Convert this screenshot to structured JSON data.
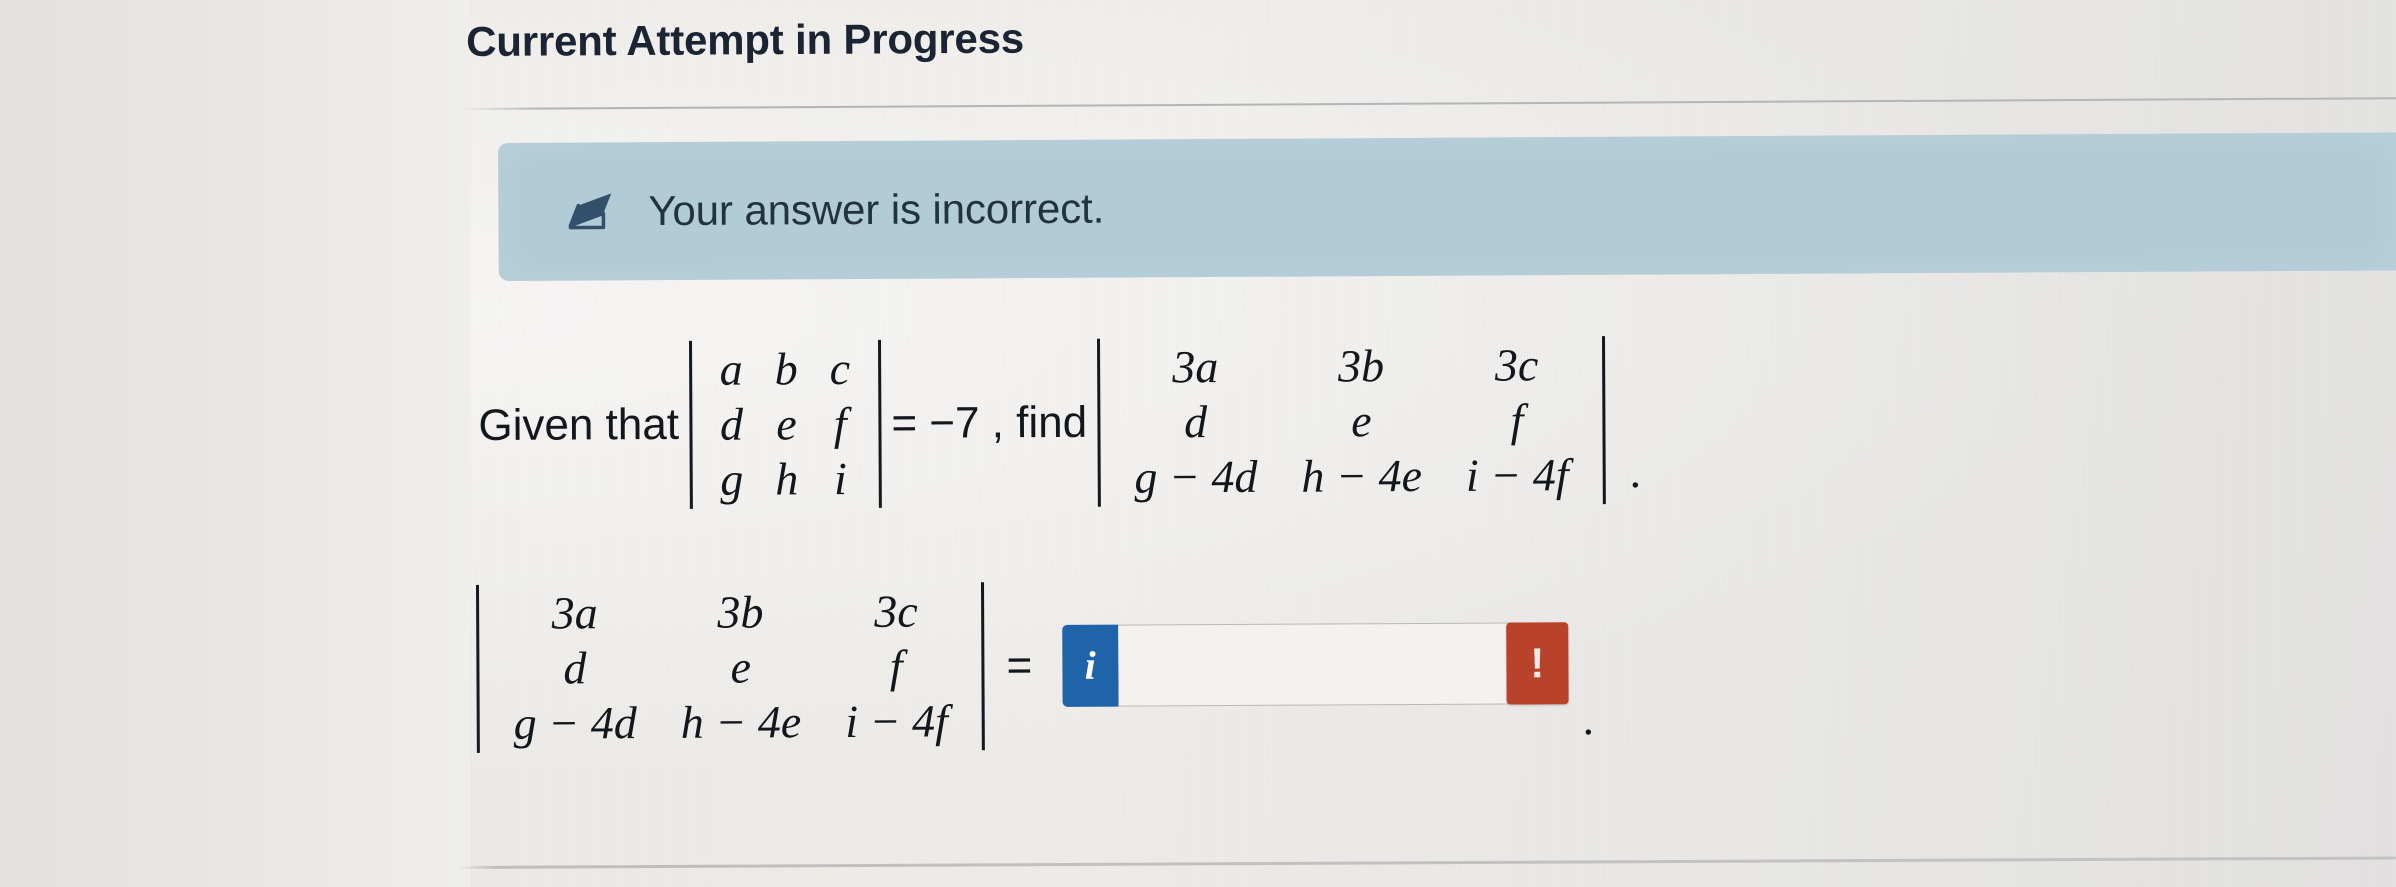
{
  "page": {
    "title": "Current Attempt in Progress"
  },
  "status_banner": {
    "message": "Your answer is incorrect.",
    "icon": "eraser-icon",
    "background_color": "#b2ccd7",
    "text_color": "#22333f"
  },
  "problem": {
    "line1": {
      "lead_text": "Given that",
      "given_determinant": {
        "rows": [
          [
            "a",
            "b",
            "c"
          ],
          [
            "d",
            "e",
            "f"
          ],
          [
            "g",
            "h",
            "i"
          ]
        ]
      },
      "relation_text": "= −7 , find",
      "target_determinant": {
        "rows": [
          [
            "3a",
            "3b",
            "3c"
          ],
          [
            "d",
            "e",
            "f"
          ],
          [
            "g − 4d",
            "h − 4e",
            "i − 4f"
          ]
        ]
      },
      "trailing_punctuation": "."
    },
    "line2": {
      "determinant": {
        "rows": [
          [
            "3a",
            "3b",
            "3c"
          ],
          [
            "d",
            "e",
            "f"
          ],
          [
            "g − 4d",
            "h − 4e",
            "i − 4f"
          ]
        ]
      },
      "equals_sign": "=",
      "trailing_punctuation": "."
    }
  },
  "answer_field": {
    "value": "",
    "placeholder": "",
    "info_button_label": "i",
    "info_button_color": "#1f63a8",
    "warning_button_label": "!",
    "warning_button_color": "#b8432a"
  }
}
